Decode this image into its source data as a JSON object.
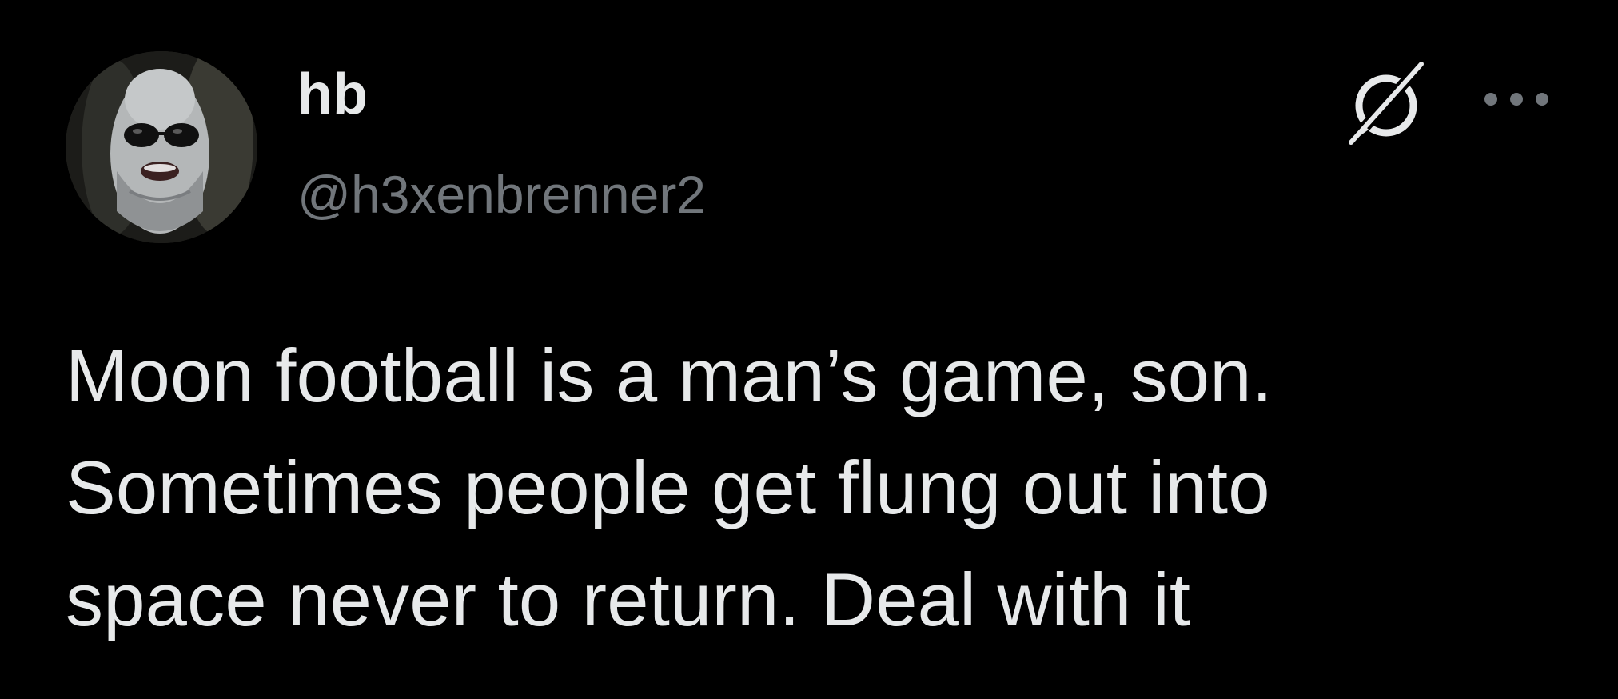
{
  "author": {
    "display_name": "hb",
    "handle": "@h3xenbrenner2",
    "avatar": "avatar-photo"
  },
  "icons": {
    "grok": "grok-icon",
    "more": "more-options-icon"
  },
  "tweet": {
    "text": "Moon football is a man’s game, son.\nSometimes people get flung out into\nspace never to return. Deal with it"
  },
  "colors": {
    "background": "#000000",
    "primary_text": "#e7e9ea",
    "secondary_text": "#71767b"
  }
}
